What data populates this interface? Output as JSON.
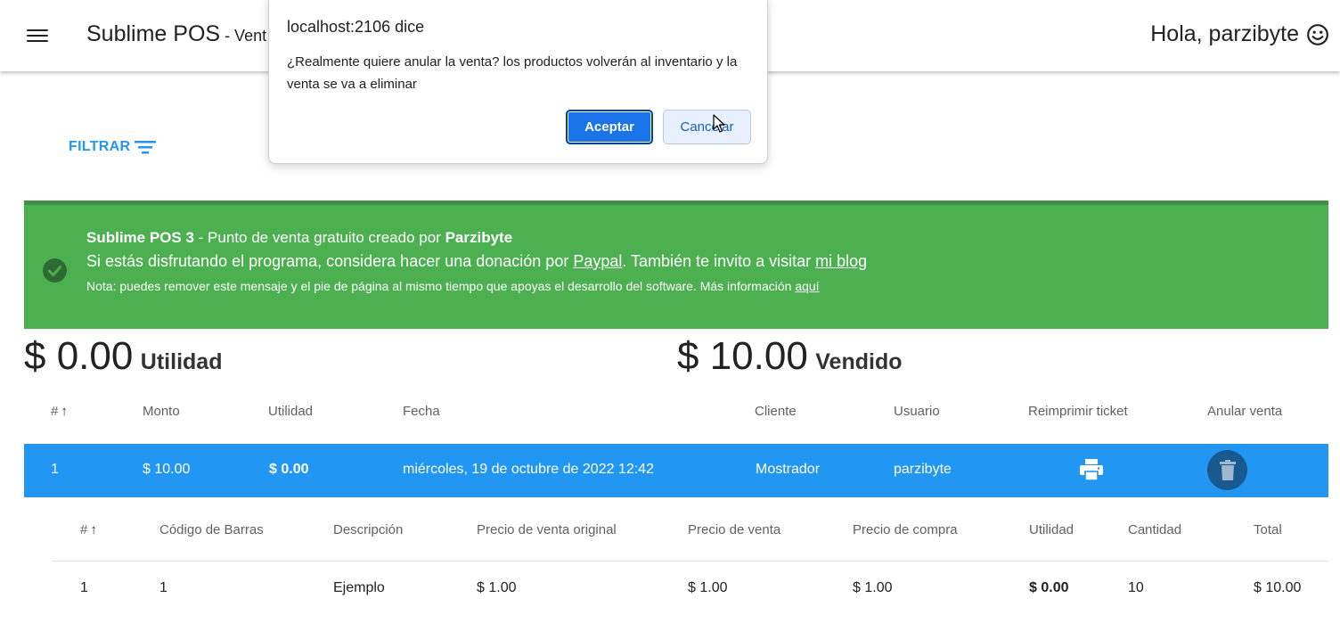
{
  "appbar": {
    "title": "Sublime POS",
    "subtitle": " - Vent",
    "greeting": "Hola, parzibyte"
  },
  "filter": {
    "label": "FILTRAR"
  },
  "banner": {
    "brand": "Sublime POS 3",
    "l1_mid": " - Punto de venta gratuito creado por ",
    "author": "Parzibyte",
    "l2_pre": "Si estás disfrutando el programa, considera hacer una donación por ",
    "paypal": "Paypal",
    "l2_mid": ". También te invito a visitar ",
    "blog": "mi blog",
    "l3_pre": "Nota: puedes remover este mensaje y el pie de página al mismo tiempo que apoyas el desarrollo del software. Más información ",
    "aqui": "aquí"
  },
  "totals": {
    "utilidad_amount": "$ 0.00",
    "utilidad_label": "Utilidad",
    "vendido_amount": "$ 10.00",
    "vendido_label": "Vendido"
  },
  "sales_table": {
    "headers": [
      "#",
      "Monto",
      "Utilidad",
      "Fecha",
      "Cliente",
      "Usuario",
      "Reimprimir ticket",
      "Anular venta"
    ],
    "row": {
      "id": "1",
      "monto": "$ 10.00",
      "utilidad": "$ 0.00",
      "fecha": "miércoles, 19 de octubre de 2022 12:42",
      "cliente": "Mostrador",
      "usuario": "parzibyte"
    }
  },
  "detail_table": {
    "headers": [
      "#",
      "Código de Barras",
      "Descripción",
      "Precio de venta original",
      "Precio de venta",
      "Precio de compra",
      "Utilidad",
      "Cantidad",
      "Total"
    ],
    "row": {
      "id": "1",
      "codigo": "1",
      "descripcion": "Ejemplo",
      "precio_original": "$ 1.00",
      "precio_venta": "$ 1.00",
      "precio_compra": "$ 1.00",
      "utilidad": "$ 0.00",
      "cantidad": "10",
      "total": "$ 10.00"
    }
  },
  "dialog": {
    "title": "localhost:2106 dice",
    "message": "¿Realmente quiere anular la venta? los productos volverán al inventario y la venta se va a eliminar",
    "accept": "Aceptar",
    "cancel": "Cancelar"
  },
  "colors": {
    "primary": "#2196f3",
    "success": "#4caf50",
    "dialog_accept": "#1a73e8"
  },
  "icons": [
    "menu-icon",
    "smile-icon",
    "filter-icon",
    "check-circle-icon",
    "sort-arrow-up-icon",
    "print-icon",
    "trash-icon",
    "cursor-icon"
  ]
}
